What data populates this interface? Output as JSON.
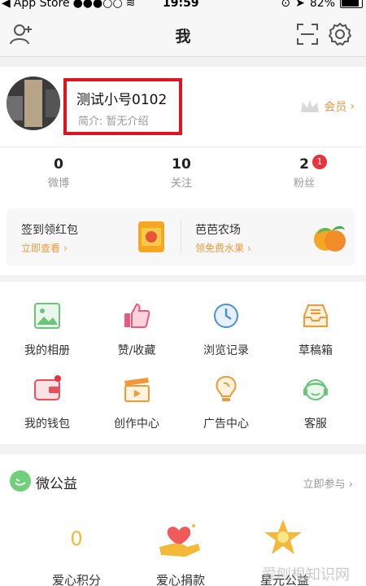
{
  "status_bar": {
    "carrier": "App Store",
    "signal": "●●●○○",
    "time": "19:59",
    "battery": "82%"
  },
  "nav": {
    "title": "我",
    "icons": [
      "add-friend-icon",
      "scan-icon",
      "settings-icon"
    ]
  },
  "profile": {
    "username": "测试小号0102",
    "bio": "简介: 暂无介绍",
    "vip_label": "会员"
  },
  "stats": [
    {
      "count": "0",
      "label": "微博"
    },
    {
      "count": "10",
      "label": "关注"
    },
    {
      "count": "2",
      "label": "粉丝",
      "badge": "1"
    }
  ],
  "promos": [
    {
      "title": "签到领红包",
      "action": "立即查看 ›"
    },
    {
      "title": "芭芭农场",
      "action": "领免费水果 ›"
    }
  ],
  "grid": [
    {
      "label": "我的相册",
      "icon": "album-icon"
    },
    {
      "label": "赞/收藏",
      "icon": "like-icon"
    },
    {
      "label": "浏览记录",
      "icon": "history-icon"
    },
    {
      "label": "草稿箱",
      "icon": "drafts-icon"
    },
    {
      "label": "我的钱包",
      "icon": "wallet-icon"
    },
    {
      "label": "创作中心",
      "icon": "creator-icon"
    },
    {
      "label": "广告中心",
      "icon": "ad-icon"
    },
    {
      "label": "客服",
      "icon": "support-icon"
    }
  ],
  "charity": {
    "title": "微公益",
    "more": "立即参与 ›",
    "items": [
      {
        "value": "0",
        "label": "爱心积分"
      },
      {
        "label": "爱心捐款",
        "icon": "donate-icon"
      },
      {
        "label": "星元公益",
        "icon": "star-charity-icon"
      }
    ]
  },
  "watermark": "爱刨根知识网",
  "colors": {
    "accent_orange": "#f1983a",
    "badge_red": "#e8323c",
    "highlight_red": "#e0141e"
  }
}
